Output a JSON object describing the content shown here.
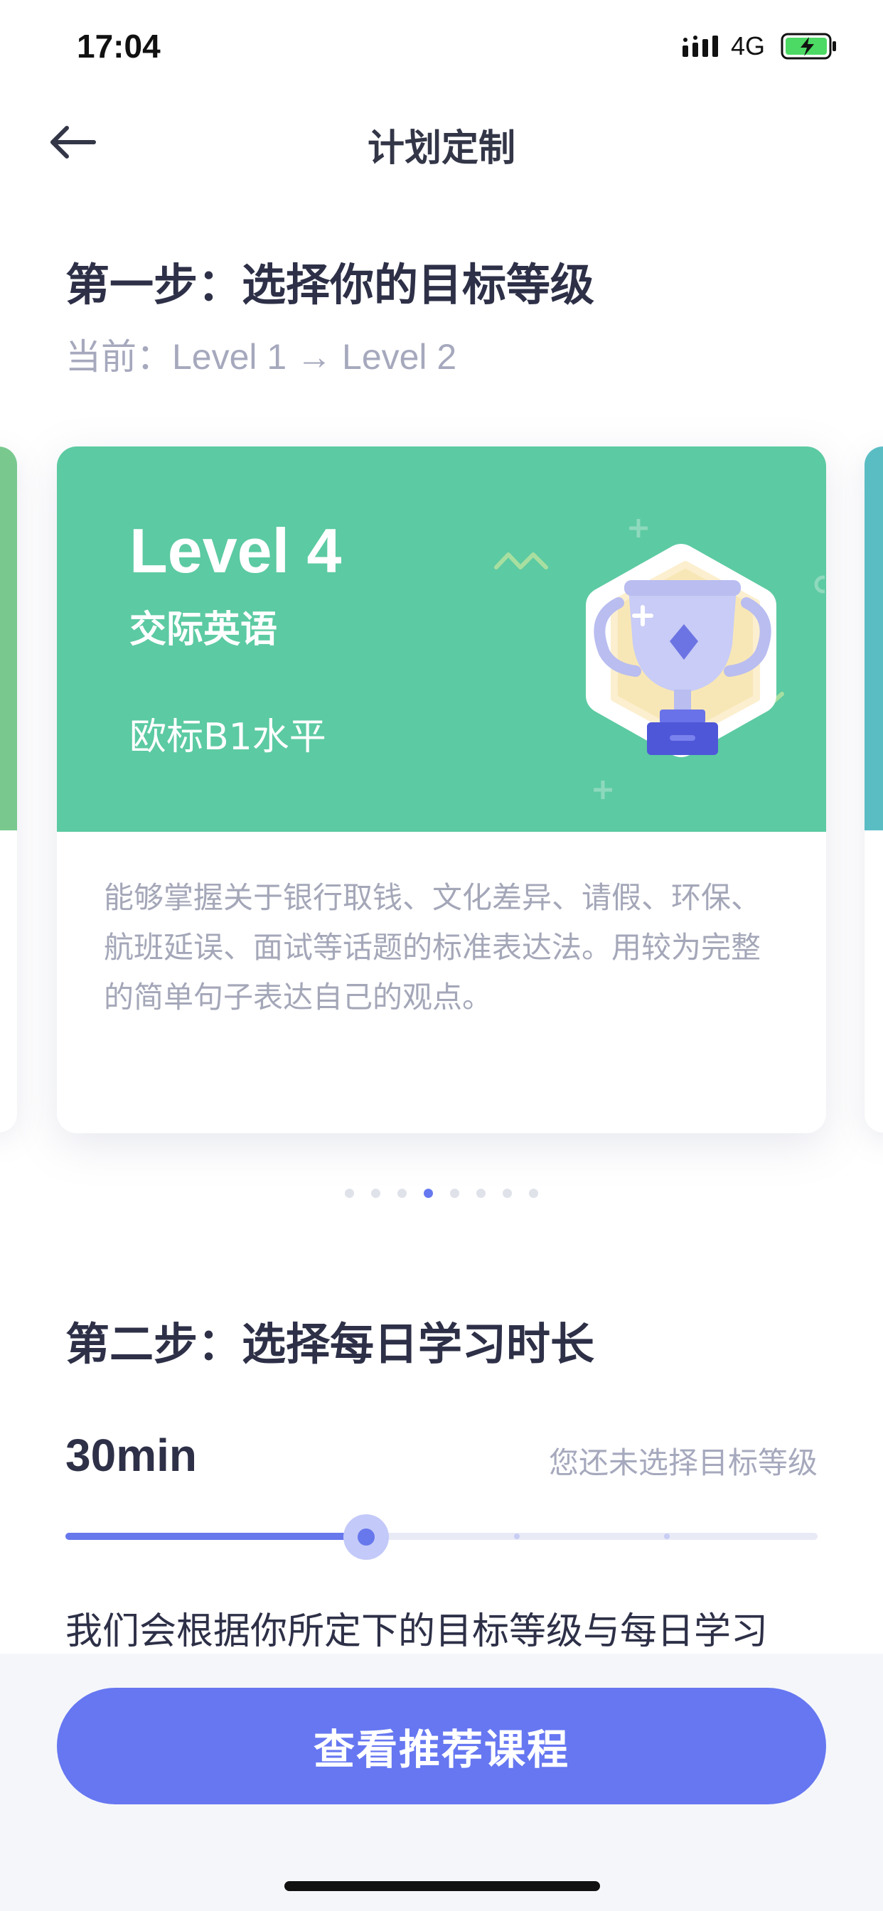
{
  "status_bar": {
    "time": "17:04",
    "network": "4G",
    "icons": [
      "signal-icon",
      "battery-charging-icon"
    ]
  },
  "nav": {
    "title": "计划定制",
    "back_icon": "arrow-left-icon"
  },
  "step1": {
    "title": "第一步：选择你的目标等级",
    "current": "当前：Level 1 → Level 2"
  },
  "carousel": {
    "active_index": 3,
    "total": 8,
    "card": {
      "level": "Level 4",
      "subtitle": "交际英语",
      "standard": "欧标B1水平",
      "description": "能够掌握关于银行取钱、文化差异、请假、环保、航班延误、面试等话题的标准表达法。用较为完整的简单句子表达自己的观点。",
      "badge_icon": "trophy-icon",
      "color": "#5ccaa2"
    },
    "side_colors": [
      "#79c98f",
      "#5bbdc4"
    ]
  },
  "step2": {
    "title": "第二步：选择每日学习时长",
    "duration": "30min",
    "hint": "您还未选择目标等级",
    "slider": {
      "value_fraction": 0.4,
      "tick_fractions": [
        0.6,
        0.8
      ]
    },
    "info": "我们会根据你所定下的目标等级与每日学习"
  },
  "cta": {
    "label": "查看推荐课程"
  },
  "colors": {
    "accent": "#6677f1",
    "text": "#2d3047",
    "muted": "#a6a9bd"
  }
}
